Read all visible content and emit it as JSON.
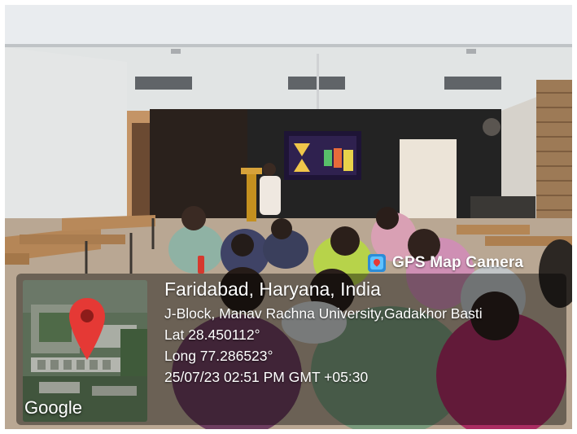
{
  "overlay": {
    "app_name": "GPS Map Camera",
    "location_title": "Faridabad, Haryana, India",
    "address": "J-Block, Manav Rachna University,Gadakhor Basti",
    "latitude": "Lat 28.450112°",
    "longitude": "Long 77.286523°",
    "timestamp": "25/07/23 02:51 PM GMT +05:30",
    "map_brand": "Google",
    "icons": {
      "app": "gps-map-camera-icon",
      "pin": "map-pin-icon"
    },
    "colors": {
      "pin": "#e53935",
      "panel": "#000000",
      "text": "#ffffff"
    }
  }
}
